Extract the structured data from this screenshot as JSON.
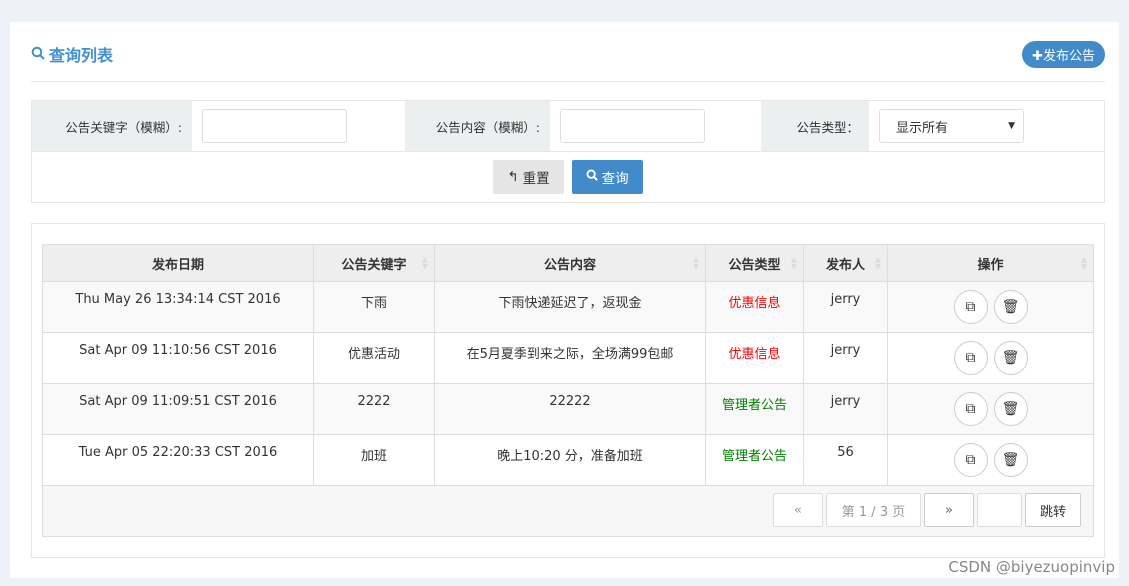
{
  "header": {
    "title": "查询列表",
    "publish_label": "发布公告"
  },
  "filter": {
    "keyword_label": "公告关键字（模糊）:",
    "keyword_value": "",
    "content_label": "公告内容（模糊）:",
    "content_value": "",
    "type_label": "公告类型：",
    "type_selected": "显示所有",
    "reset_label": "重置",
    "query_label": "查询"
  },
  "table": {
    "headers": [
      "发布日期",
      "公告关键字",
      "公告内容",
      "公告类型",
      "发布人",
      "操作"
    ],
    "rows": [
      {
        "date": "Thu May 26 13:34:14 CST 2016",
        "keyword": "下雨",
        "content": "下雨快递延迟了，返现金",
        "type": "优惠信息",
        "type_color": "#ff0000",
        "publisher": "jerry"
      },
      {
        "date": "Sat Apr 09 11:10:56 CST 2016",
        "keyword": "优惠活动",
        "content": "在5月夏季到来之际，全场满99包邮",
        "type": "优惠信息",
        "type_color": "#ff0000",
        "publisher": "jerry"
      },
      {
        "date": "Sat Apr 09 11:09:51 CST 2016",
        "keyword": "2222",
        "content": "22222",
        "type": "管理者公告",
        "type_color": "#008000",
        "publisher": "jerry"
      },
      {
        "date": "Tue Apr 05 22:20:33 CST 2016",
        "keyword": "加班",
        "content": "晚上10:20 分，准备加班",
        "type": "管理者公告",
        "type_color": "#008000",
        "publisher": "56"
      }
    ]
  },
  "pager": {
    "prev": "«",
    "page_info": "第 1 / 3 页",
    "next": "»",
    "jump_value": "",
    "jump_label": "跳转"
  },
  "watermark": "CSDN @biyezuopinvip"
}
